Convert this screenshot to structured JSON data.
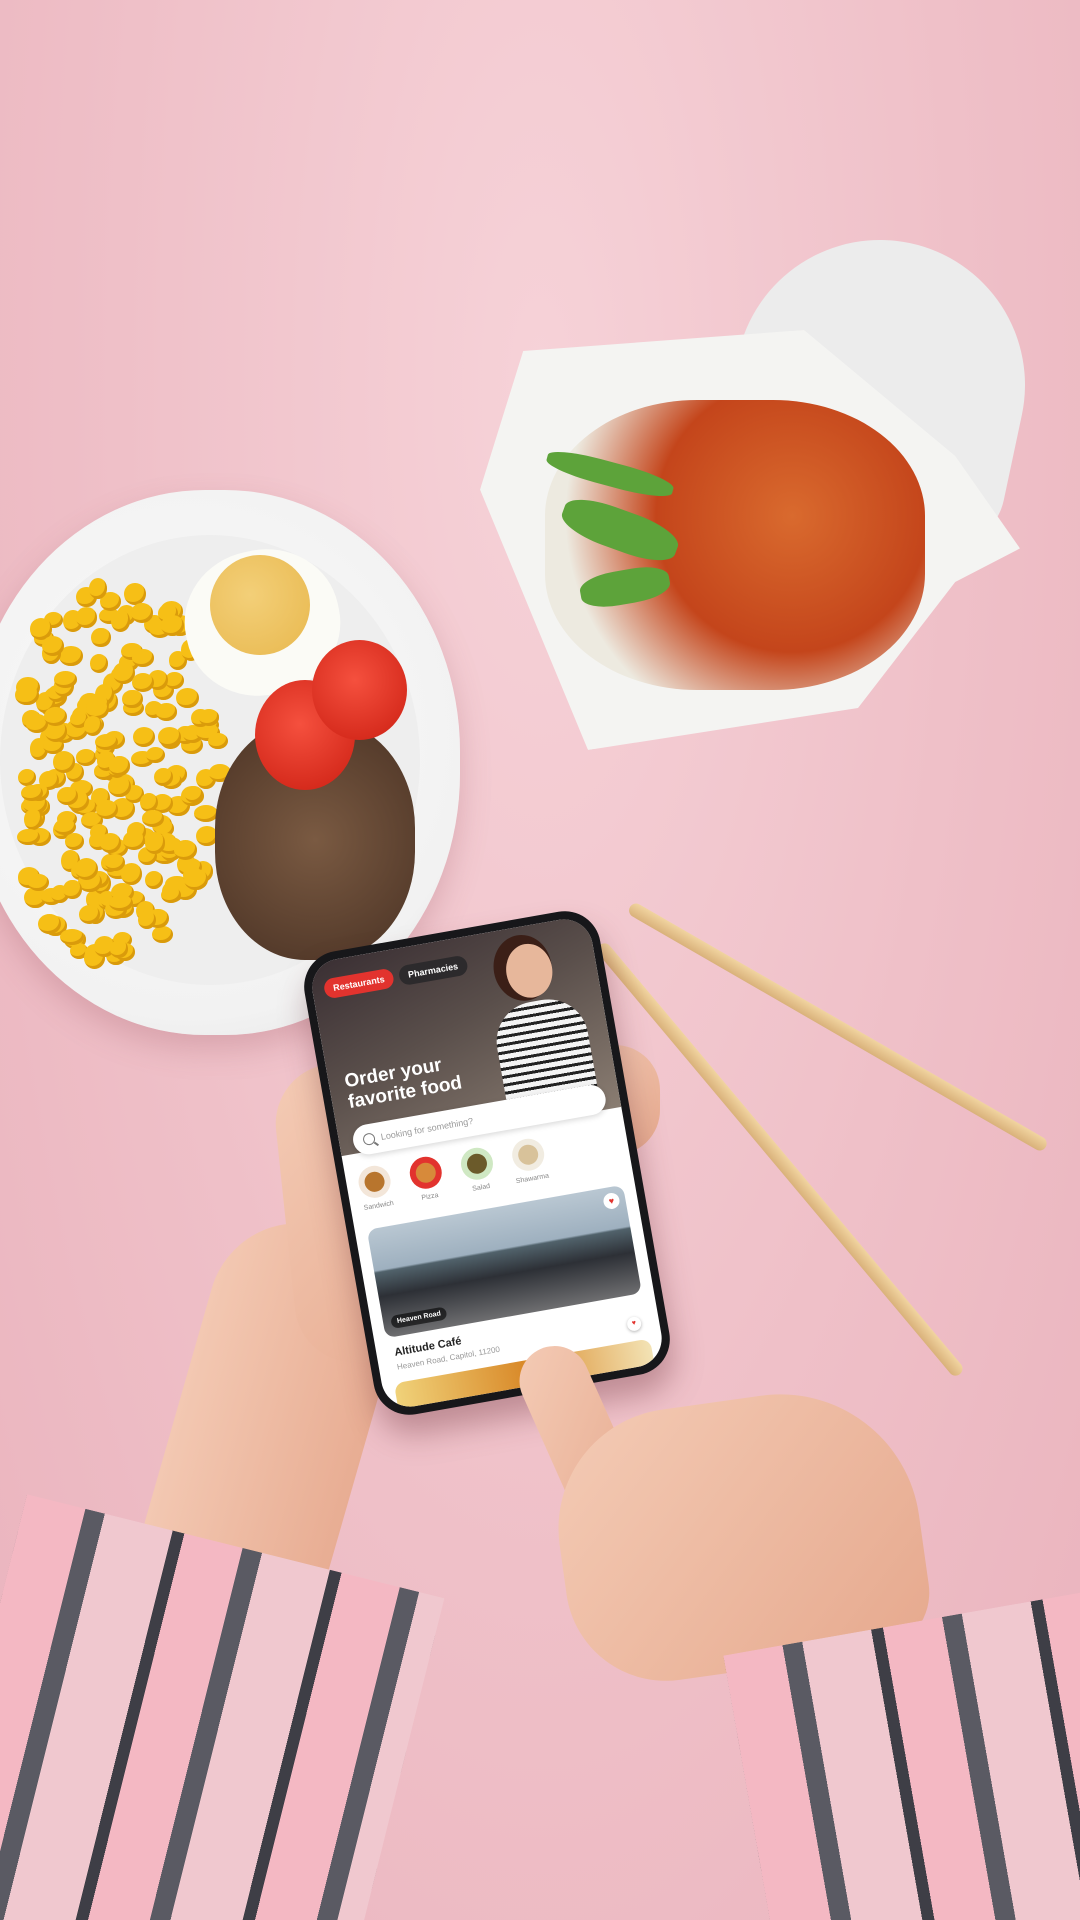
{
  "app": {
    "tabs": [
      {
        "label": "Restaurants",
        "active": true
      },
      {
        "label": "Pharmacies",
        "active": false
      }
    ],
    "hero_title": "Order your favorite food",
    "search": {
      "placeholder": "Looking for something?"
    },
    "categories": [
      {
        "label": "Sandwich",
        "icon": "sandwich-icon"
      },
      {
        "label": "Pizza",
        "icon": "pizza-icon"
      },
      {
        "label": "Salad",
        "icon": "salad-icon"
      },
      {
        "label": "Shawarma",
        "icon": "shawarma-icon"
      }
    ],
    "card": {
      "tag": "Heaven Road",
      "title": "Altitude Café",
      "subtitle": "Heaven Road, Capitol, 11200"
    },
    "colors": {
      "accent": "#e2332e"
    }
  }
}
